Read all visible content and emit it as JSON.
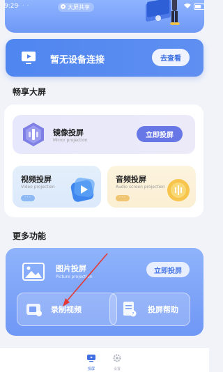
{
  "status_bar": {
    "time": "9:29",
    "dots": "· · ·"
  },
  "banner": {
    "tag": "大屏共享"
  },
  "device_card": {
    "title": "暂无设备连接",
    "button": "去查看"
  },
  "share_section": {
    "title": "畅享大屏",
    "mirror": {
      "title": "镜像投屏",
      "subtitle": "Mirror projection",
      "button": "立即投屏"
    },
    "video": {
      "title": "视频投屏",
      "subtitle": "Video projection",
      "pill": "···"
    },
    "audio": {
      "title": "音频投屏",
      "subtitle": "Audio screen projection",
      "pill": "···"
    }
  },
  "more_section": {
    "title": "更多功能",
    "picture": {
      "title": "图片投屏",
      "subtitle": "Picture projection",
      "button": "立即投屏"
    },
    "record": {
      "label": "录制视频"
    },
    "help": {
      "label": "投屏帮助"
    }
  },
  "bottom_nav": [
    {
      "label": "投屏",
      "icon": "cast-icon",
      "active": true
    },
    {
      "label": "设置",
      "icon": "gear-icon",
      "active": false
    }
  ],
  "colors": {
    "accent": "#4f86f0",
    "mirror_button": "#6877e6",
    "annotation_arrow": "#e53935"
  },
  "annotation": {
    "points_to": "record-video-tile"
  }
}
